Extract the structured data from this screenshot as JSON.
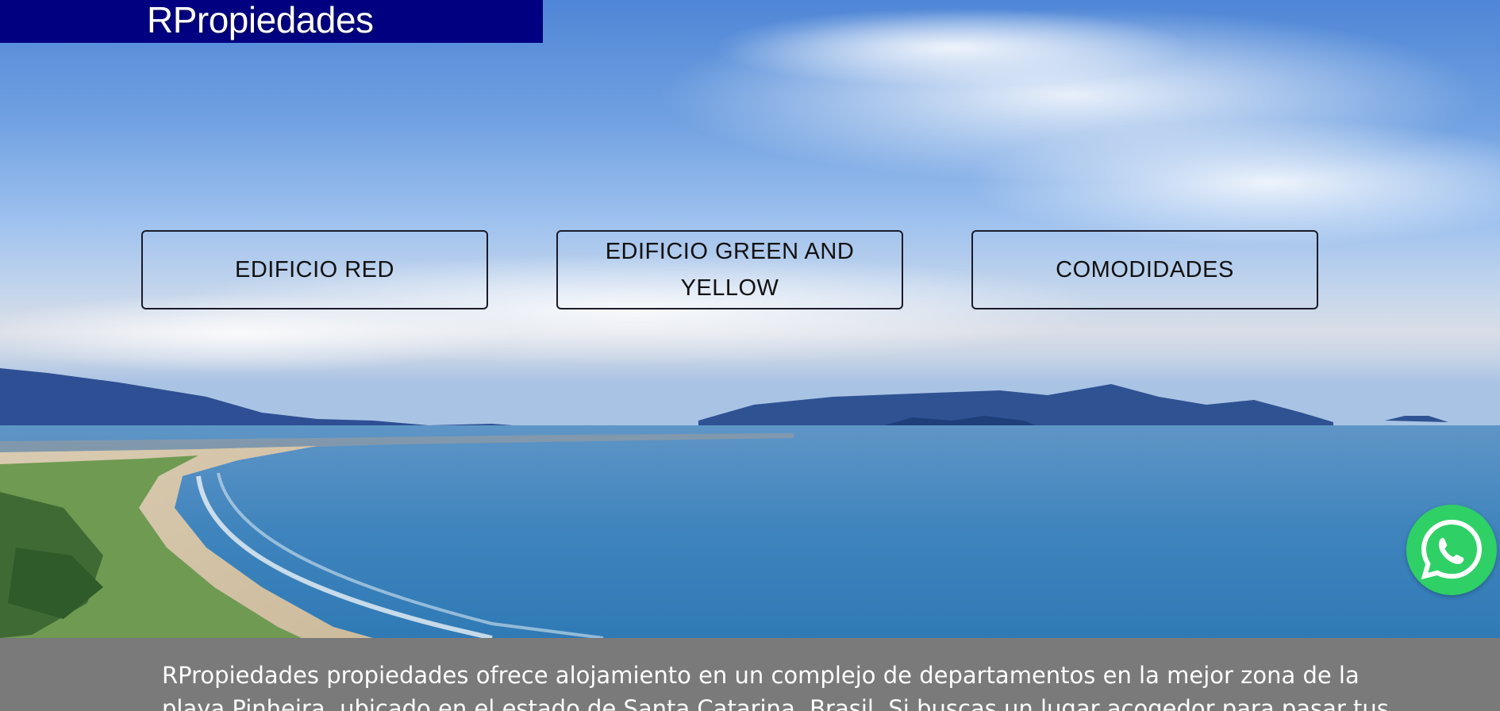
{
  "header": {
    "logo_text": "RPropiedades",
    "logo_bg_color": "#000080"
  },
  "nav": {
    "buttons": [
      {
        "label": "EDIFICIO RED"
      },
      {
        "label": "EDIFICIO GREEN AND YELLOW"
      },
      {
        "label": "COMODIDADES"
      }
    ]
  },
  "floating": {
    "whatsapp_icon": "whatsapp-icon",
    "whatsapp_color": "#2fd066"
  },
  "description": {
    "line_1": "RPropiedades propiedades ofrece alojamiento en un complejo de departamentos en la mejor zona de la",
    "line_2": "playa Pinheira, ubicado en el estado de Santa Catarina, Brasil. Si buscas un lugar acogedor para pasar tus"
  },
  "colors": {
    "footer_bg": "#7a7a7a",
    "button_border": "#1a1a2a"
  }
}
